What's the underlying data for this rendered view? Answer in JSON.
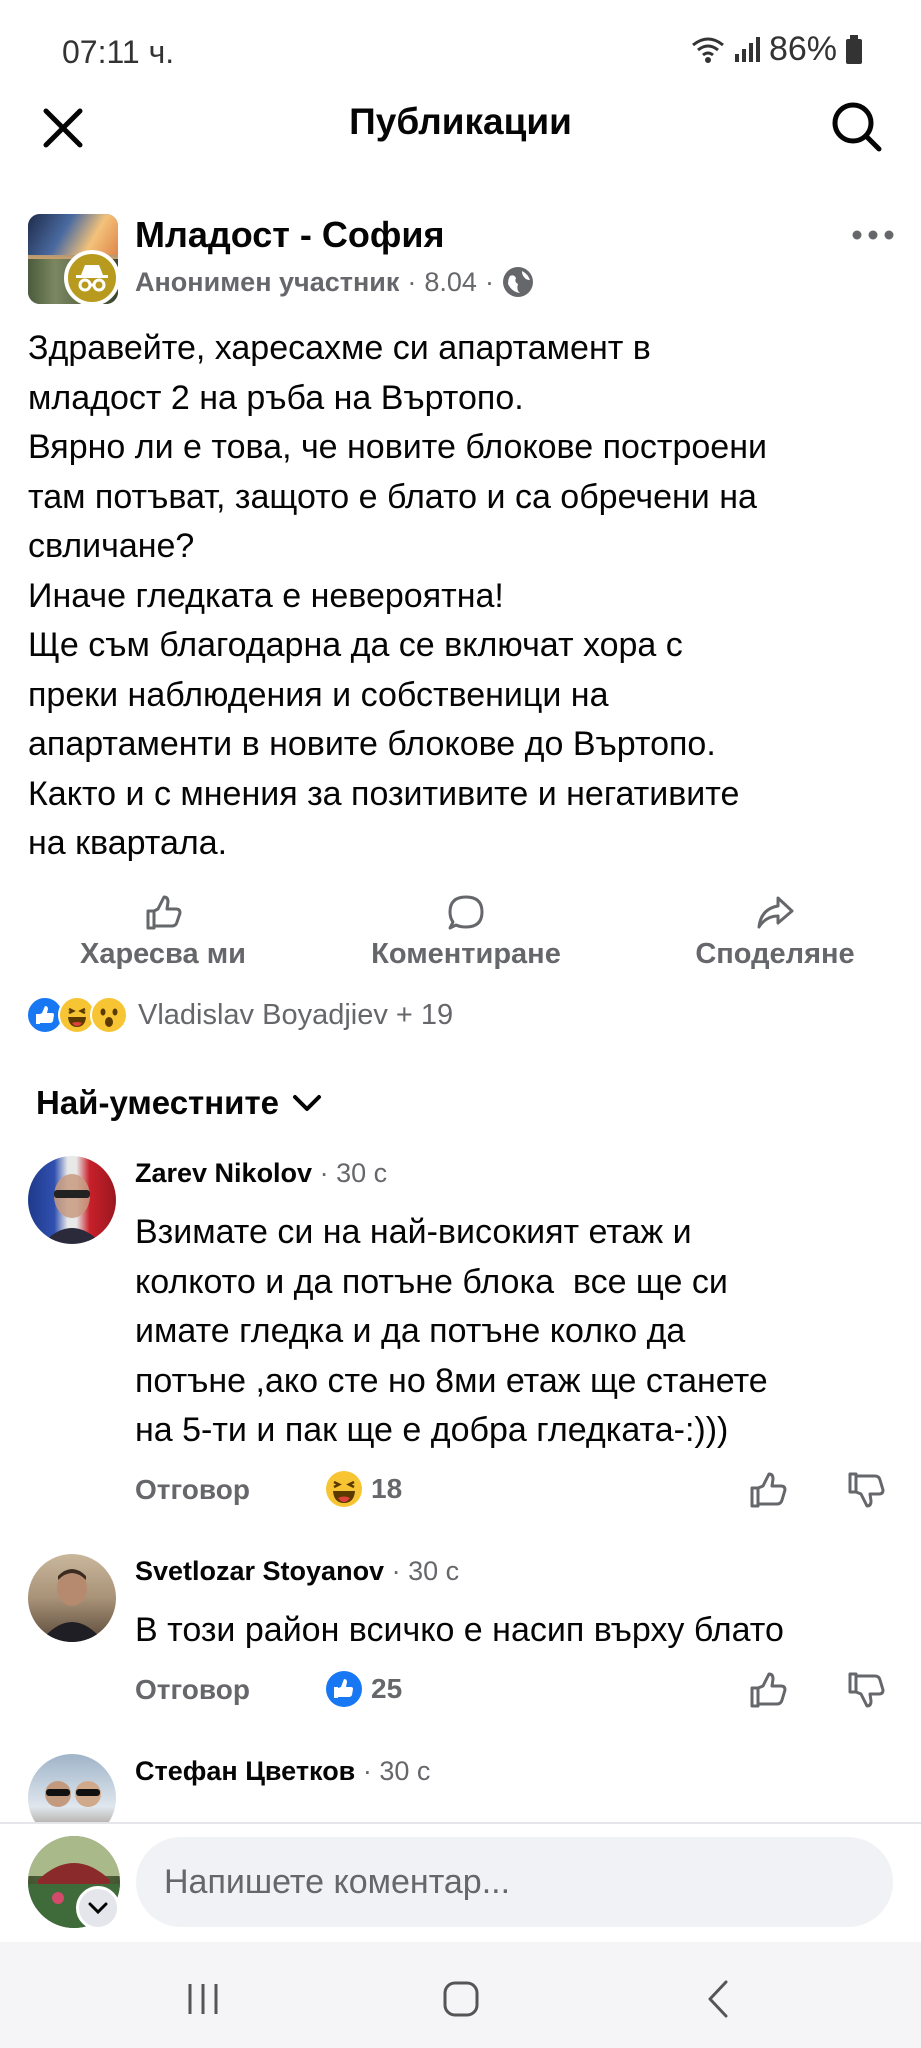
{
  "status": {
    "time": "07:11 ч.",
    "battery": "86%"
  },
  "topbar": {
    "title": "Публикации"
  },
  "post": {
    "group": "Младост - София",
    "author": "Анонимен участник",
    "date": "8.04",
    "body": [
      "Здравейте, харесахме си апартамент в",
      "младост 2 на ръба на Въртопо.",
      "Вярно ли е това, че новите блокове построени",
      "там потъват, защото е блато и са обречени на",
      "свличане?",
      "Иначе гледката е невероятна!",
      "Ще съм благодарна да се включат хора с",
      "преки наблюдения и собственици на",
      "апартаменти в новите блокове до Въртопо.",
      "Както и с мнения за позитивите и негативите",
      "на квартала."
    ]
  },
  "actions": {
    "like": "Харесва ми",
    "comment": "Коментиране",
    "share": "Споделяне"
  },
  "reactions": {
    "summary": "Vladislav Boyadjiev + 19"
  },
  "sort": {
    "label": "Най-уместните"
  },
  "comments": [
    {
      "name": "Zarev Nikolov",
      "time": "30 с",
      "text": [
        "Взимате си на най-високият етаж и",
        "колкото и да потъне блока  все ще си",
        "имате гледка и да потъне колко да",
        "потъне ,ако сте но 8ми етаж ще станете",
        "на 5-ти и пак ще е добра гледката-:)))"
      ],
      "reply": "Отговор",
      "reaction_count": "18",
      "reaction_type": "haha"
    },
    {
      "name": "Svetlozar Stoyanov",
      "time": "30 с",
      "text": [
        "В този район всичко е насип върху блато"
      ],
      "reply": "Отговор",
      "reaction_count": "25",
      "reaction_type": "like"
    },
    {
      "name": "Стефан Цветков",
      "time": "30 с"
    }
  ],
  "composer": {
    "placeholder": "Напишете коментар..."
  },
  "colors": {
    "facebook_blue": "#1877f2",
    "secondary_text": "#65676b",
    "anon_badge": "#b89a1e"
  }
}
